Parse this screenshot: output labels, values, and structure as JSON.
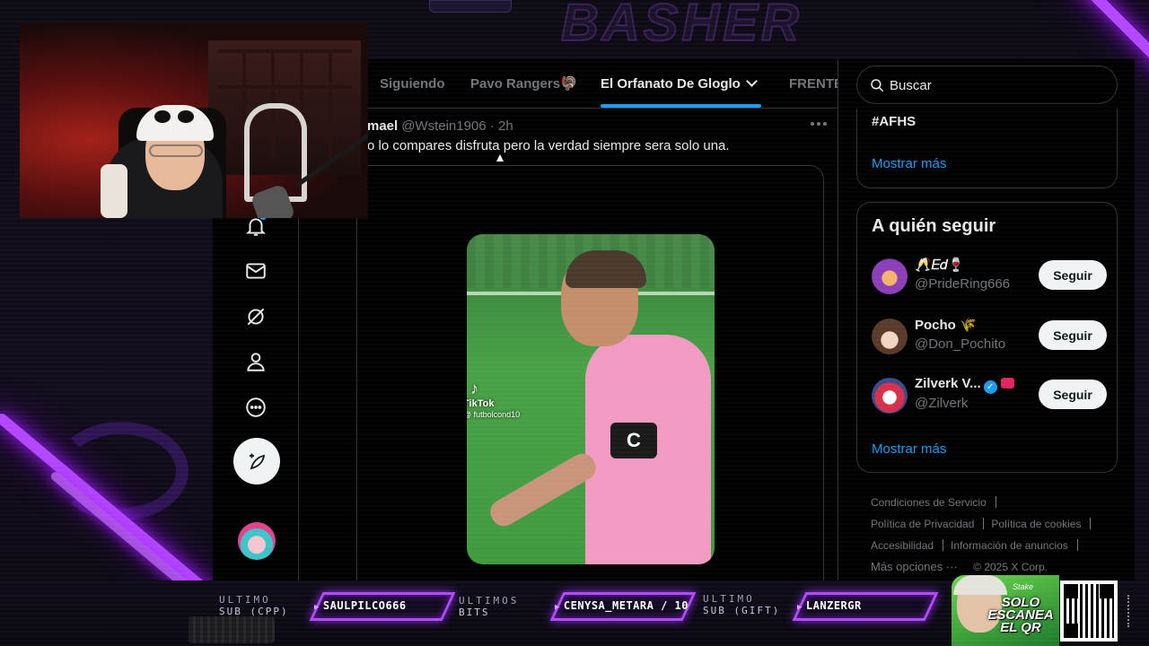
{
  "overlay": {
    "brand": "BASHER",
    "bottom_bar": {
      "last_sub_label": "ULTIMO",
      "last_sub_sub": "SUB (CPP)",
      "last_sub_value": "SAULPILCO666",
      "last_bits_label": "ULTIMOS",
      "last_bits_sub": "BITS",
      "last_bits_value": "CENYSA_METARA / 10",
      "last_gift_label": "ULTIMO",
      "last_gift_sub": "SUB (GIFT)",
      "last_gift_value": "LANZERGR",
      "promo_brand": "Stake",
      "promo_text": "SOLO ESCANEA EL QR"
    }
  },
  "sidebar": {
    "icons": [
      "bell-icon",
      "mail-icon",
      "grok-icon",
      "profile-icon",
      "more-icon"
    ],
    "post_button_icon": "compose-icon"
  },
  "timeline": {
    "tabs": [
      {
        "label": "Siguiendo",
        "active": false
      },
      {
        "label": "Pavo Rangers🦃",
        "active": false
      },
      {
        "label": "El Orfanato De Gloglo",
        "active": true
      },
      {
        "label": "FRENTE",
        "active": false
      }
    ],
    "tweet": {
      "name": "mael",
      "handle": "@Wstein1906 · 2h",
      "text": "o lo compares disfruta pero la verdad siempre sera solo una.",
      "media": {
        "watermark_brand": "TikTok",
        "watermark_handle": "@ futbolcond10",
        "captain_letter": "C"
      }
    }
  },
  "right_column": {
    "search_placeholder": "Buscar",
    "trend_card": {
      "trend": "#AFHS",
      "show_more": "Mostrar más"
    },
    "who_to_follow": {
      "title": "A quién seguir",
      "accounts": [
        {
          "name": "🥂𝐸𝑑🍷",
          "handle": "@PrideRing666",
          "button": "Seguir"
        },
        {
          "name": "Pocho 🌾",
          "handle": "@Don_Pochito",
          "button": "Seguir"
        },
        {
          "name": "Zilverk V...",
          "handle": "@Zilverk",
          "button": "Seguir",
          "verified": true
        }
      ],
      "show_more": "Mostrar más"
    },
    "footer": {
      "terms": "Condiciones de Servicio",
      "privacy": "Política de Privacidad",
      "cookies": "Política de cookies",
      "accessibility": "Accesibilidad",
      "ads_info": "Información de anuncios",
      "more": "Más opciones ···",
      "copyright": "© 2025 X Corp."
    }
  },
  "colors": {
    "accent": "#1d9bf0",
    "neon": "#b347ff",
    "background": "#000000"
  }
}
